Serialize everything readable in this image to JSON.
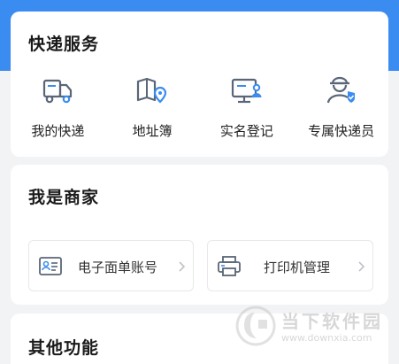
{
  "colors": {
    "header_blue": "#3b8cf0",
    "icon_stroke": "#5a6677",
    "icon_accent": "#3b8cf0",
    "background": "#f2f3f5"
  },
  "express_services": {
    "title": "快递服务",
    "items": [
      {
        "label": "我的快递",
        "icon": "delivery-truck-icon"
      },
      {
        "label": "地址簿",
        "icon": "address-book-pin-icon"
      },
      {
        "label": "实名登记",
        "icon": "monitor-user-icon"
      },
      {
        "label": "专属快递员",
        "icon": "courier-badge-icon"
      }
    ]
  },
  "merchant": {
    "title": "我是商家",
    "tools": [
      {
        "label": "电子面单账号",
        "icon": "id-card-icon"
      },
      {
        "label": "打印机管理",
        "icon": "printer-icon"
      }
    ]
  },
  "other": {
    "title": "其他功能"
  },
  "watermark": {
    "name": "当下软件园",
    "url": "www.downxia.com"
  }
}
